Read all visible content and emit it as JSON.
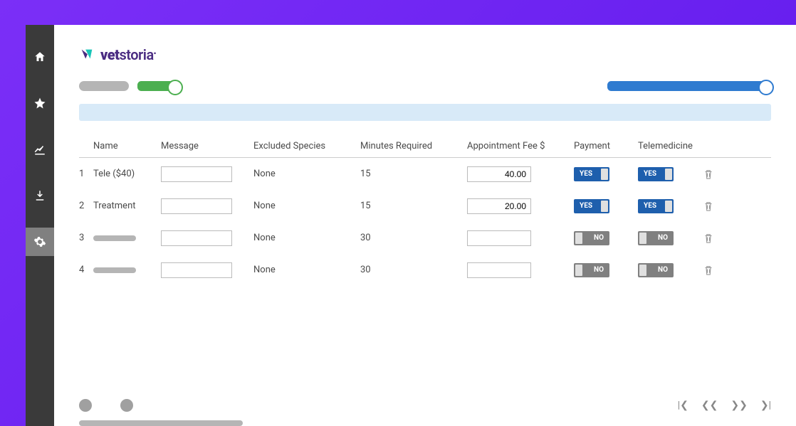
{
  "brand": {
    "name": "vetstoria"
  },
  "headers": {
    "name": "Name",
    "message": "Message",
    "excluded": "Excluded Species",
    "minutes": "Minutes Required",
    "fee": "Appointment Fee $",
    "payment": "Payment",
    "telemedicine": "Telemedicine"
  },
  "rows": [
    {
      "idx": "1",
      "name": "Tele ($40)",
      "name_placeholder": false,
      "excluded": "None",
      "minutes": "15",
      "fee": "40.00",
      "payment": "YES",
      "tele": "YES"
    },
    {
      "idx": "2",
      "name": "Treatment",
      "name_placeholder": false,
      "excluded": "None",
      "minutes": "15",
      "fee": "20.00",
      "payment": "YES",
      "tele": "YES"
    },
    {
      "idx": "3",
      "name": "",
      "name_placeholder": true,
      "excluded": "None",
      "minutes": "30",
      "fee": "",
      "payment": "NO",
      "tele": "NO"
    },
    {
      "idx": "4",
      "name": "",
      "name_placeholder": true,
      "excluded": "None",
      "minutes": "30",
      "fee": "",
      "payment": "NO",
      "tele": "NO"
    }
  ],
  "toggles": {
    "yes": "YES",
    "no": "NO"
  }
}
